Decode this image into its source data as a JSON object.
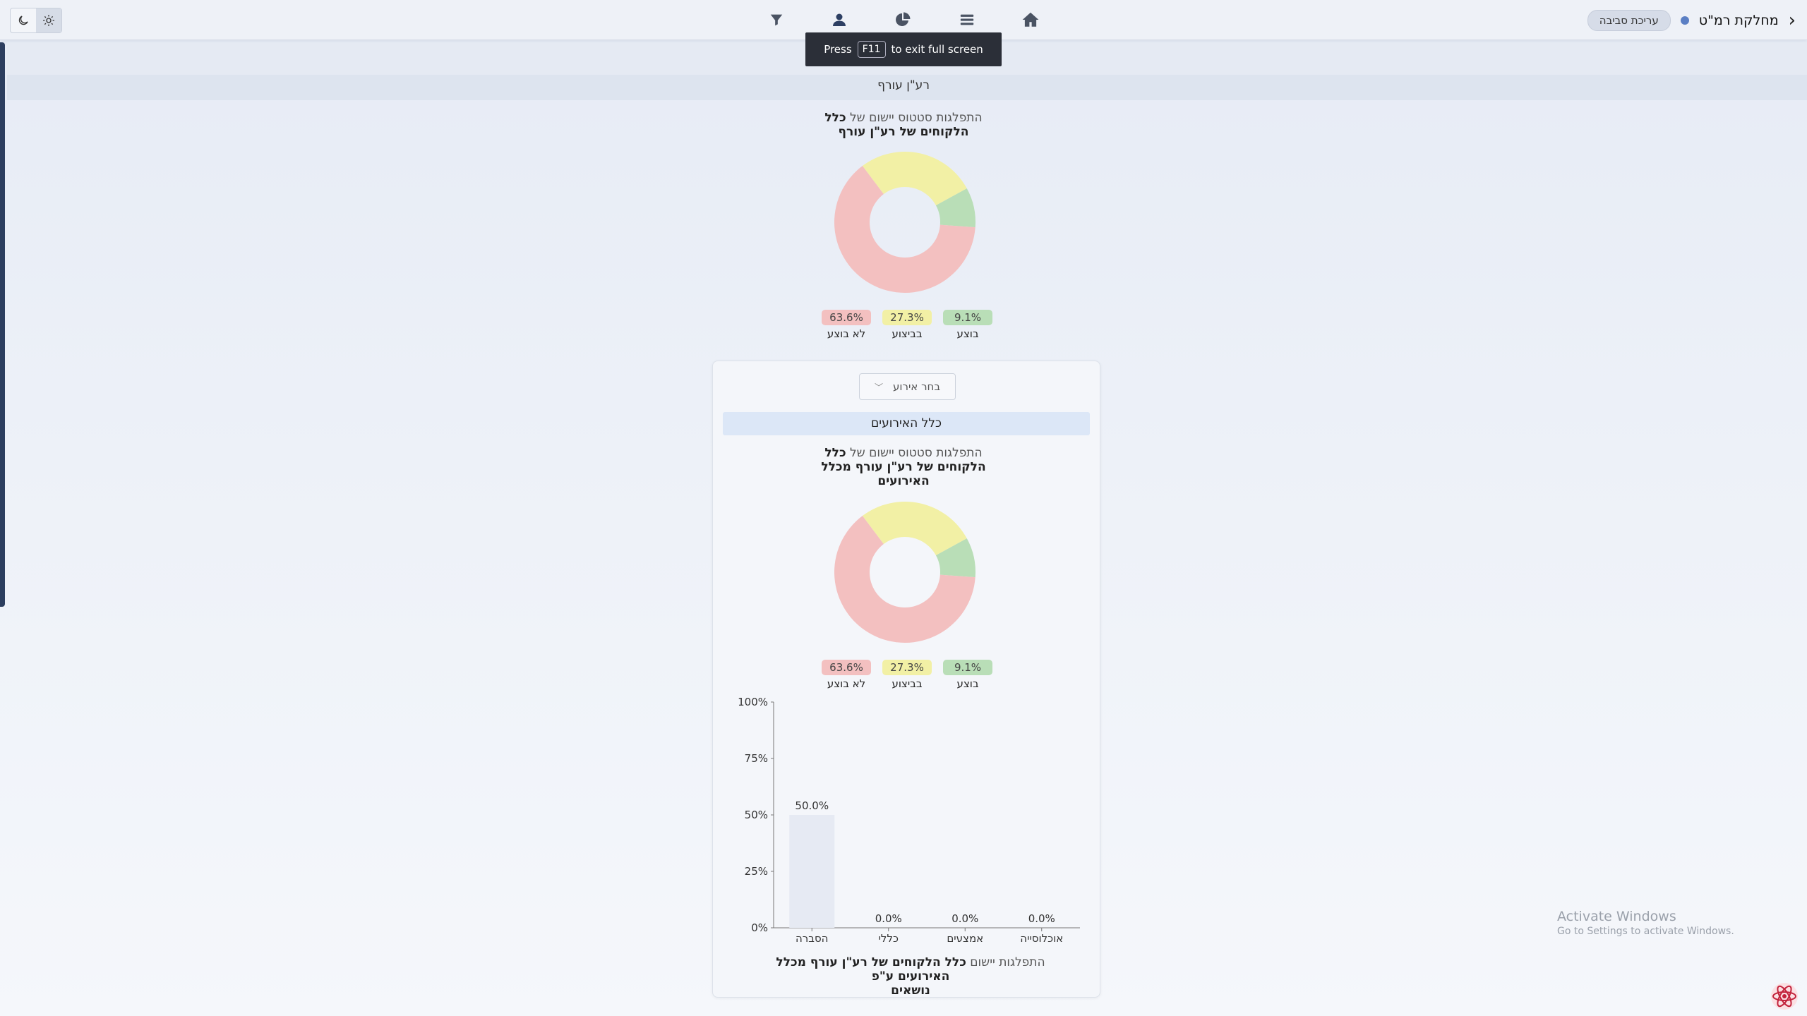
{
  "header": {
    "app_name": "מחלקת רמ\"ט",
    "edit_label": "עריכת סביבה",
    "back_glyph": "‹",
    "nav_icons": [
      "home-icon",
      "menu-icon",
      "pie-chart-icon",
      "user-icon",
      "filter-icon"
    ],
    "theme_icons": [
      "moon-icon",
      "sun-icon"
    ]
  },
  "fullscreen_tip": {
    "press": "Press",
    "key": "F11",
    "rest": "to exit full screen"
  },
  "section": {
    "title": "רע\"ן עורף"
  },
  "top_chart": {
    "title_plain": "התפלגות סטטוס יישום של ",
    "title_bold_1": "כלל",
    "title_bold_2": "הלקוחים של רע\"ן עורף"
  },
  "card": {
    "select_label": "בחר אירוע",
    "events_band": "כלל האירועים",
    "chart_title_plain": "התפלגות סטטוס יישום של ",
    "chart_title_bold_1": "כלל",
    "chart_title_bold_2": "הלקוחים של רע\"ן עורף מכלל",
    "chart_title_bold_3": "האירועים",
    "bar_title_plain": "התפלגות יישום ",
    "bar_title_bold_1": "כלל הלקוחים של רע\"ן עורף מכלל האירועים ע\"פ",
    "bar_title_bold_2": "נושאים"
  },
  "colors": {
    "done": "#b9deb7",
    "in_progress": "#f2f0a5",
    "not_done": "#f3c0c0",
    "done_pill": "#b9deb7",
    "in_progress_pill": "#f2f0a5",
    "not_done_pill": "#f3c0c0",
    "bar_fill": "#e6eaf3"
  },
  "chart_data": [
    {
      "type": "pie",
      "categories": [
        "בוצע",
        "בביצוע",
        "לא בוצע"
      ],
      "values": [
        9.1,
        27.3,
        63.6
      ],
      "labels": [
        "9.1%",
        "27.3%",
        "63.6%"
      ]
    },
    {
      "type": "pie",
      "categories": [
        "בוצע",
        "בביצוע",
        "לא בוצע"
      ],
      "values": [
        9.1,
        27.3,
        63.6
      ],
      "labels": [
        "9.1%",
        "27.3%",
        "63.6%"
      ]
    },
    {
      "type": "bar",
      "categories": [
        "הסברה",
        "כללי",
        "אמצעים",
        "אוכלוסייה"
      ],
      "values": [
        50.0,
        0.0,
        0.0,
        0.0
      ],
      "value_labels": [
        "50.0%",
        "0.0%",
        "0.0%",
        "0.0%"
      ],
      "y_ticks": [
        "0%",
        "25%",
        "50%",
        "75%",
        "100%"
      ],
      "ylim": [
        0,
        100
      ]
    }
  ],
  "watermark": {
    "line1": "Activate Windows",
    "line2": "Go to Settings to activate Windows."
  }
}
